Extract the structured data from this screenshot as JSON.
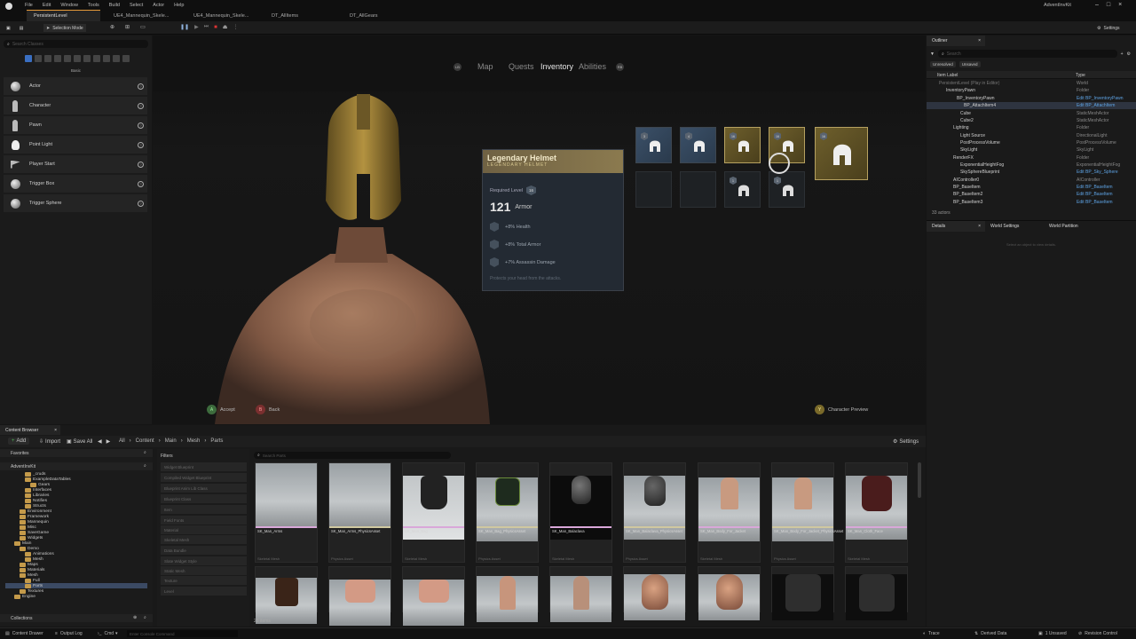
{
  "app": {
    "menu": [
      "File",
      "Edit",
      "Window",
      "Tools",
      "Build",
      "Select",
      "Actor",
      "Help"
    ],
    "project": "AdventInvKit"
  },
  "tabs": [
    "PersistentLevel",
    "UE4_Mannequin_Skele...",
    "UE4_Mannequin_Skele...",
    "DT_AllItems",
    "DT_AllGears"
  ],
  "toolbar": {
    "mode": "Selection Mode",
    "settings": "Settings"
  },
  "place_actors": {
    "search_placeholder": "Search Classes",
    "category": "Basic",
    "items": [
      "Actor",
      "Character",
      "Pawn",
      "Point Light",
      "Player Start",
      "Trigger Box",
      "Trigger Sphere"
    ]
  },
  "game_ui": {
    "left_bumper": "LB",
    "right_bumper": "RB",
    "nav": [
      "Map",
      "Quests",
      "Inventory",
      "Abilities"
    ],
    "active_nav": "Inventory",
    "tooltip": {
      "name": "Legendary Helmet",
      "rarity": "LEGENDARY HELMET",
      "required_label": "Required Level",
      "required_value": "16",
      "armor_value": "121",
      "armor_label": "Armor",
      "stats": [
        "+8% Health",
        "+8% Total Armor",
        "+7% Assassin Damage"
      ],
      "flavor": "Protects your head from the attacks."
    },
    "slot_levels": [
      "3",
      "4",
      "16",
      "16",
      "16",
      "",
      "",
      "1",
      "1"
    ],
    "hints": {
      "accept_key": "A",
      "accept": "Accept",
      "back_key": "B",
      "back": "Back",
      "preview_key": "Y",
      "preview": "Character Preview"
    }
  },
  "outliner": {
    "title": "Outliner",
    "search_placeholder": "Search",
    "filters": [
      "Unresolved",
      "Unsaved"
    ],
    "col_label": "Item Label",
    "col_type": "Type",
    "rows": [
      {
        "name": "PersistentLevel (Play in Editor)",
        "type": "World"
      },
      {
        "name": "InventoryPawn",
        "type": "Folder"
      },
      {
        "name": "BP_InventoryPawn",
        "type": "Edit BP_InventoryPawn"
      },
      {
        "name": "BP_AttachItem4",
        "type": "Edit BP_AttachItem"
      },
      {
        "name": "Cube",
        "type": "StaticMeshActor"
      },
      {
        "name": "Cube2",
        "type": "StaticMeshActor"
      },
      {
        "name": "Lighting",
        "type": "Folder"
      },
      {
        "name": "Light Source",
        "type": "DirectionalLight"
      },
      {
        "name": "PostProcessVolume",
        "type": "PostProcessVolume"
      },
      {
        "name": "SkyLight",
        "type": "SkyLight"
      },
      {
        "name": "RenderFX",
        "type": "Folder"
      },
      {
        "name": "ExponentialHeightFog",
        "type": "ExponentialHeightFog"
      },
      {
        "name": "SkySphereBlueprint",
        "type": "Edit BP_Sky_Sphere"
      },
      {
        "name": "AIController0",
        "type": "AIController"
      },
      {
        "name": "BP_BaseItem",
        "type": "Edit BP_BaseItem"
      },
      {
        "name": "BP_BaseItem2",
        "type": "Edit BP_BaseItem"
      },
      {
        "name": "BP_BaseItem3",
        "type": "Edit BP_BaseItem"
      }
    ],
    "count": "33 actors"
  },
  "details": {
    "tabs": [
      "Details",
      "World Settings",
      "World Partition"
    ],
    "empty": "Select an object to view details."
  },
  "content_browser": {
    "title": "Content Browser",
    "add": "Add",
    "import": "Import",
    "save_all": "Save All",
    "path": [
      "All",
      "Content",
      "Main",
      "Mesh",
      "Parts"
    ],
    "settings": "Settings",
    "favorites": "Favorites",
    "root": "AdventInvKit",
    "tree": [
      "_cruds",
      "ExampleDataTables",
      "Gears",
      "Interfaces",
      "Libraries",
      "Notifies",
      "Structs",
      "Environment",
      "Framework",
      "Mannequin",
      "Misc",
      "SaveGame",
      "Widgets",
      "Main",
      "Demo",
      "Animations",
      "Mesh",
      "Maps",
      "Materials",
      "Mesh",
      "Full",
      "Parts",
      "Textures",
      "Engine"
    ],
    "collections": "Collections",
    "filters_title": "Filters",
    "filters": [
      "Widget Blueprint",
      "Compiled Widget Blueprint",
      "Blueprint Anim Lib Class",
      "Blueprint Class",
      "Item",
      "Field Fonts",
      "Material",
      "Skeletal Mesh",
      "Data Bundle",
      "Slate Widget Style",
      "Static Mesh",
      "Texture",
      "Level"
    ],
    "search_placeholder": "Search Parts",
    "assets": [
      {
        "name": "SK_Man_Arms",
        "type": "Skeletal Mesh"
      },
      {
        "name": "SK_Man_Arms_PhysicsAsset",
        "type": "Physics Asset"
      },
      {
        "name": "SK_Man_Bag",
        "type": "Skeletal Mesh"
      },
      {
        "name": "SK_Man_Bag_PhysicsAsset",
        "type": "Physics Asset"
      },
      {
        "name": "SK_Man_Balaclava",
        "type": "Skeletal Mesh"
      },
      {
        "name": "SK_Man_Balaclava_PhysicsAsset",
        "type": "Physics Asset"
      },
      {
        "name": "SK_Man_Body_For_Jacket",
        "type": "Skeletal Mesh"
      },
      {
        "name": "SK_Man_Body_For_Jacket_PhysicsAsset",
        "type": "Physics Asset"
      },
      {
        "name": "SK_Man_Cloth_Face",
        "type": "Skeletal Mesh"
      }
    ],
    "item_count": "28 items"
  },
  "statusbar": {
    "drawer": "Content Drawer",
    "log": "Output Log",
    "cmd": "Cmd",
    "console_placeholder": "Enter Console Command",
    "trace": "Trace",
    "ddc": "Derived Data",
    "unsaved": "1 Unsaved",
    "revision": "Revision Control"
  },
  "colors": {
    "accent": "#e59a3a",
    "gold": "#b6a160",
    "link": "#5ea3e4"
  }
}
